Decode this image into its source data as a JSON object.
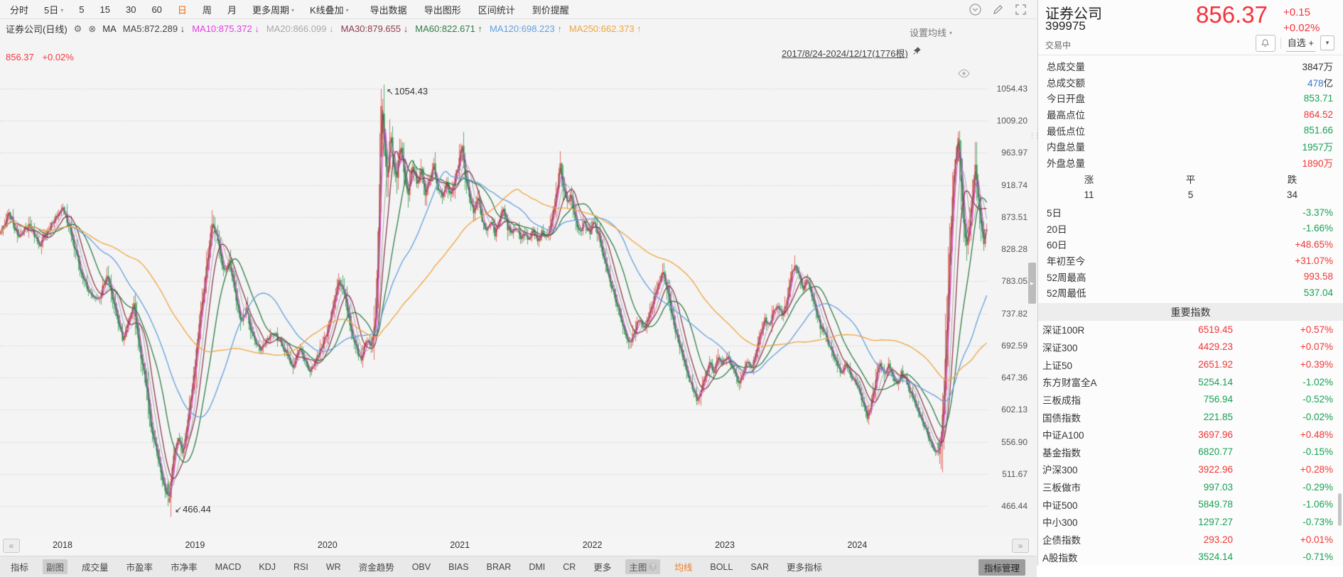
{
  "toolbar": {
    "periods": [
      {
        "label": "分时"
      },
      {
        "label": "5日",
        "caret": true
      },
      {
        "label": "5"
      },
      {
        "label": "15"
      },
      {
        "label": "30"
      },
      {
        "label": "60"
      },
      {
        "label": "日",
        "active": true
      },
      {
        "label": "周"
      },
      {
        "label": "月"
      },
      {
        "label": "更多周期",
        "caret": true
      },
      {
        "label": "K线叠加",
        "caret": true
      }
    ],
    "actions": [
      "导出数据",
      "导出图形",
      "区间统计",
      "到价提醒"
    ],
    "right_icons": [
      "collapse-circle-icon",
      "edit-icon",
      "fullscreen-icon"
    ]
  },
  "legend": {
    "name": "证券公司(日线)",
    "ma_label": "MA",
    "price": "856.37",
    "change": "+0.02%",
    "icons": [
      "gear-icon",
      "close-circle-icon"
    ]
  },
  "chart_header": {
    "ma_settings_label": "设置均线",
    "date_range": "2017/8/24-2024/12/17(1776根)",
    "pin_icon": "pin-icon",
    "corner_icon": "eye-icon"
  },
  "chart_data": {
    "type": "candlestick",
    "title": "证券公司(日线)",
    "symbol": "399975",
    "bar_count": 1776,
    "date_start": "2017/8/24",
    "date_end": "2024/12/17",
    "y_ticks": [
      "1054.43",
      "1009.20",
      "963.97",
      "918.74",
      "873.51",
      "828.28",
      "783.05",
      "737.82",
      "692.59",
      "647.36",
      "602.13",
      "556.90",
      "511.67",
      "466.44"
    ],
    "x_years": [
      "2018",
      "2019",
      "2020",
      "2021",
      "2022",
      "2023",
      "2024"
    ],
    "annotations": {
      "high_label": "1054.43",
      "low_label": "466.44"
    },
    "extremes": {
      "all_time_high": 1054.43,
      "all_time_low": 466.44,
      "high_52w": 993.58,
      "low_52w": 537.04
    },
    "last_bar": {
      "open": 853.71,
      "high": 864.52,
      "low": 851.66,
      "close": 856.37
    },
    "colors": {
      "up": "#dd4f4a",
      "down": "#2f9b53",
      "grid": "#cbcbcb"
    },
    "ma_lines": [
      {
        "name": "MA5",
        "value": "872.289",
        "dir": "↓",
        "color": "#555555",
        "window": 5
      },
      {
        "name": "MA10",
        "value": "875.372",
        "dir": "↓",
        "color": "#df3fdf",
        "window": 10
      },
      {
        "name": "MA20",
        "value": "866.099",
        "dir": "↓",
        "color": "#a9a9a9",
        "window": 20
      },
      {
        "name": "MA30",
        "value": "879.655",
        "dir": "↓",
        "color": "#8e3a4e",
        "window": 30
      },
      {
        "name": "MA60",
        "value": "822.671",
        "dir": "↑",
        "color": "#2e7d46",
        "window": 60
      },
      {
        "name": "MA120",
        "value": "698.223",
        "dir": "↑",
        "color": "#639fdf",
        "window": 120
      },
      {
        "name": "MA250",
        "value": "662.373",
        "dir": "↑",
        "color": "#f0a43f",
        "window": 250
      }
    ],
    "price_path": [
      [
        0,
        850
      ],
      [
        12,
        880
      ],
      [
        25,
        845
      ],
      [
        40,
        862
      ],
      [
        55,
        835
      ],
      [
        70,
        858
      ],
      [
        88,
        886
      ],
      [
        100,
        852
      ],
      [
        112,
        800
      ],
      [
        125,
        768
      ],
      [
        138,
        756
      ],
      [
        150,
        790
      ],
      [
        162,
        742
      ],
      [
        172,
        700
      ],
      [
        180,
        724
      ],
      [
        188,
        748
      ],
      [
        196,
        688
      ],
      [
        205,
        638
      ],
      [
        212,
        578
      ],
      [
        220,
        545
      ],
      [
        228,
        504
      ],
      [
        237,
        470
      ],
      [
        243,
        532
      ],
      [
        250,
        562
      ],
      [
        257,
        540
      ],
      [
        264,
        586
      ],
      [
        272,
        648
      ],
      [
        280,
        722
      ],
      [
        290,
        802
      ],
      [
        298,
        866
      ],
      [
        306,
        838
      ],
      [
        314,
        798
      ],
      [
        322,
        812
      ],
      [
        330,
        768
      ],
      [
        338,
        724
      ],
      [
        346,
        742
      ],
      [
        355,
        704
      ],
      [
        365,
        686
      ],
      [
        375,
        700
      ],
      [
        385,
        712
      ],
      [
        395,
        694
      ],
      [
        405,
        678
      ],
      [
        412,
        660
      ],
      [
        420,
        688
      ],
      [
        428,
        672
      ],
      [
        436,
        655
      ],
      [
        444,
        670
      ],
      [
        452,
        692
      ],
      [
        460,
        710
      ],
      [
        468,
        748
      ],
      [
        476,
        786
      ],
      [
        484,
        766
      ],
      [
        492,
        722
      ],
      [
        500,
        690
      ],
      [
        508,
        672
      ],
      [
        515,
        700
      ],
      [
        522,
        690
      ],
      [
        528,
        730
      ],
      [
        532,
        850
      ],
      [
        535,
        960
      ],
      [
        537,
        1030
      ],
      [
        541,
        975
      ],
      [
        545,
        922
      ],
      [
        549,
        995
      ],
      [
        553,
        948
      ],
      [
        558,
        930
      ],
      [
        563,
        982
      ],
      [
        568,
        938
      ],
      [
        574,
        905
      ],
      [
        580,
        948
      ],
      [
        586,
        920
      ],
      [
        592,
        936
      ],
      [
        598,
        905
      ],
      [
        604,
        926
      ],
      [
        610,
        944
      ],
      [
        616,
        912
      ],
      [
        622,
        900
      ],
      [
        628,
        918
      ],
      [
        634,
        905
      ],
      [
        640,
        928
      ],
      [
        646,
        952
      ],
      [
        650,
        972
      ],
      [
        654,
        934
      ],
      [
        660,
        904
      ],
      [
        666,
        880
      ],
      [
        672,
        902
      ],
      [
        678,
        872
      ],
      [
        684,
        852
      ],
      [
        690,
        866
      ],
      [
        696,
        850
      ],
      [
        702,
        866
      ],
      [
        708,
        884
      ],
      [
        714,
        860
      ],
      [
        720,
        850
      ],
      [
        726,
        860
      ],
      [
        732,
        845
      ],
      [
        738,
        852
      ],
      [
        744,
        838
      ],
      [
        750,
        854
      ],
      [
        756,
        842
      ],
      [
        762,
        854
      ],
      [
        768,
        842
      ],
      [
        775,
        860
      ],
      [
        782,
        902
      ],
      [
        788,
        944
      ],
      [
        792,
        918
      ],
      [
        797,
        890
      ],
      [
        803,
        904
      ],
      [
        809,
        872
      ],
      [
        815,
        850
      ],
      [
        822,
        868
      ],
      [
        829,
        852
      ],
      [
        836,
        866
      ],
      [
        843,
        844
      ],
      [
        850,
        814
      ],
      [
        857,
        786
      ],
      [
        864,
        760
      ],
      [
        871,
        740
      ],
      [
        878,
        712
      ],
      [
        885,
        692
      ],
      [
        892,
        712
      ],
      [
        899,
        730
      ],
      [
        906,
        716
      ],
      [
        913,
        738
      ],
      [
        920,
        760
      ],
      [
        927,
        780
      ],
      [
        933,
        800
      ],
      [
        938,
        772
      ],
      [
        944,
        742
      ],
      [
        950,
        712
      ],
      [
        956,
        690
      ],
      [
        962,
        670
      ],
      [
        968,
        648
      ],
      [
        974,
        634
      ],
      [
        980,
        618
      ],
      [
        986,
        628
      ],
      [
        992,
        650
      ],
      [
        998,
        670
      ],
      [
        1004,
        655
      ],
      [
        1010,
        678
      ],
      [
        1016,
        666
      ],
      [
        1022,
        678
      ],
      [
        1028,
        666
      ],
      [
        1034,
        650
      ],
      [
        1040,
        638
      ],
      [
        1046,
        656
      ],
      [
        1052,
        670
      ],
      [
        1058,
        660
      ],
      [
        1064,
        684
      ],
      [
        1070,
        710
      ],
      [
        1076,
        730
      ],
      [
        1082,
        720
      ],
      [
        1088,
        738
      ],
      [
        1094,
        750
      ],
      [
        1100,
        736
      ],
      [
        1106,
        750
      ],
      [
        1112,
        786
      ],
      [
        1118,
        810
      ],
      [
        1124,
        790
      ],
      [
        1130,
        770
      ],
      [
        1136,
        786
      ],
      [
        1142,
        760
      ],
      [
        1148,
        740
      ],
      [
        1154,
        720
      ],
      [
        1160,
        710
      ],
      [
        1166,
        694
      ],
      [
        1172,
        680
      ],
      [
        1178,
        666
      ],
      [
        1184,
        650
      ],
      [
        1190,
        666
      ],
      [
        1196,
        654
      ],
      [
        1202,
        644
      ],
      [
        1208,
        630
      ],
      [
        1214,
        610
      ],
      [
        1220,
        590
      ],
      [
        1226,
        610
      ],
      [
        1232,
        646
      ],
      [
        1238,
        666
      ],
      [
        1244,
        650
      ],
      [
        1250,
        666
      ],
      [
        1256,
        648
      ],
      [
        1262,
        638
      ],
      [
        1268,
        654
      ],
      [
        1274,
        644
      ],
      [
        1280,
        628
      ],
      [
        1286,
        616
      ],
      [
        1292,
        598
      ],
      [
        1298,
        584
      ],
      [
        1304,
        568
      ],
      [
        1310,
        554
      ],
      [
        1316,
        542
      ],
      [
        1320,
        539
      ],
      [
        1324,
        560
      ],
      [
        1328,
        625
      ],
      [
        1332,
        718
      ],
      [
        1336,
        818
      ],
      [
        1340,
        902
      ],
      [
        1344,
        955
      ],
      [
        1348,
        985
      ],
      [
        1352,
        928
      ],
      [
        1356,
        866
      ],
      [
        1360,
        832
      ],
      [
        1364,
        860
      ],
      [
        1368,
        902
      ],
      [
        1372,
        948
      ],
      [
        1376,
        905
      ],
      [
        1380,
        860
      ],
      [
        1384,
        840
      ],
      [
        1388,
        856.37
      ]
    ]
  },
  "xaxis": {
    "prev": "«",
    "next": "»"
  },
  "bottom_bar": {
    "items": [
      {
        "label": "指标"
      },
      {
        "label": "副图",
        "selected": true
      },
      {
        "label": "成交量"
      },
      {
        "label": "市盈率"
      },
      {
        "label": "市净率"
      },
      {
        "label": "MACD"
      },
      {
        "label": "KDJ"
      },
      {
        "label": "RSI"
      },
      {
        "label": "WR"
      },
      {
        "label": "资金趋势"
      },
      {
        "label": "OBV"
      },
      {
        "label": "BIAS"
      },
      {
        "label": "BRAR"
      },
      {
        "label": "DMI"
      },
      {
        "label": "CR"
      },
      {
        "label": "更多"
      },
      {
        "label": "主图",
        "selected": true,
        "help": true
      },
      {
        "label": "均线",
        "accent": true
      },
      {
        "label": "BOLL"
      },
      {
        "label": "SAR"
      },
      {
        "label": "更多指标"
      }
    ],
    "manage_label": "指标管理"
  },
  "panel": {
    "title": "证券公司",
    "code": "399975",
    "status": "交易中",
    "price": "856.37",
    "change": "+0.15",
    "change_pct": "+0.02%",
    "watchlist_label": "自选 +",
    "buttons": [
      "bell-icon",
      "watchlist-add-button",
      "dropdown-caret-icon"
    ],
    "stats": [
      {
        "label": "总成交量",
        "value": "3847万",
        "color": "dark"
      },
      {
        "label": "总成交额",
        "value": "478",
        "suffix": "亿",
        "color": "blue",
        "suffix_color": "dark"
      },
      {
        "label": "今日开盘",
        "value": "853.71",
        "color": "green"
      },
      {
        "label": "最高点位",
        "value": "864.52",
        "color": "red"
      },
      {
        "label": "最低点位",
        "value": "851.66",
        "color": "green"
      },
      {
        "label": "内盘总量",
        "value": "1957万",
        "color": "green"
      },
      {
        "label": "外盘总量",
        "value": "1890万",
        "color": "red"
      }
    ],
    "updown": {
      "cols": [
        {
          "label": "涨",
          "value": "11",
          "color": "red"
        },
        {
          "label": "平",
          "value": "5",
          "color": "dark"
        },
        {
          "label": "跌",
          "value": "34",
          "color": "green"
        }
      ]
    },
    "ranges": [
      {
        "label": "5日",
        "value": "-3.37%",
        "color": "green"
      },
      {
        "label": "20日",
        "value": "-1.66%",
        "color": "green"
      },
      {
        "label": "60日",
        "value": "+48.65%",
        "color": "red"
      },
      {
        "label": "年初至今",
        "value": "+31.07%",
        "color": "red"
      },
      {
        "label": "52周最高",
        "value": "993.58",
        "color": "red"
      },
      {
        "label": "52周最低",
        "value": "537.04",
        "color": "green"
      }
    ],
    "section_title": "重要指数",
    "indices": [
      {
        "name": "深证100R",
        "value": "6519.45",
        "pct": "+0.57%",
        "color": "red"
      },
      {
        "name": "深证300",
        "value": "4429.23",
        "pct": "+0.07%",
        "color": "red"
      },
      {
        "name": "上证50",
        "value": "2651.92",
        "pct": "+0.39%",
        "color": "red"
      },
      {
        "name": "东方财富全A",
        "value": "5254.14",
        "pct": "-1.02%",
        "color": "green"
      },
      {
        "name": "三板成指",
        "value": "756.94",
        "pct": "-0.52%",
        "color": "green"
      },
      {
        "name": "国债指数",
        "value": "221.85",
        "pct": "-0.02%",
        "color": "green"
      },
      {
        "name": "中证A100",
        "value": "3697.96",
        "pct": "+0.48%",
        "color": "red"
      },
      {
        "name": "基金指数",
        "value": "6820.77",
        "pct": "-0.15%",
        "color": "green"
      },
      {
        "name": "沪深300",
        "value": "3922.96",
        "pct": "+0.28%",
        "color": "red"
      },
      {
        "name": "三板做市",
        "value": "997.03",
        "pct": "-0.29%",
        "color": "green"
      },
      {
        "name": "中证500",
        "value": "5849.78",
        "pct": "-1.06%",
        "color": "green"
      },
      {
        "name": "中小300",
        "value": "1297.27",
        "pct": "-0.73%",
        "color": "green"
      },
      {
        "name": "企债指数",
        "value": "293.20",
        "pct": "+0.01%",
        "color": "red"
      },
      {
        "name": "A股指数",
        "value": "3524.14",
        "pct": "-0.71%",
        "color": "green"
      }
    ]
  }
}
